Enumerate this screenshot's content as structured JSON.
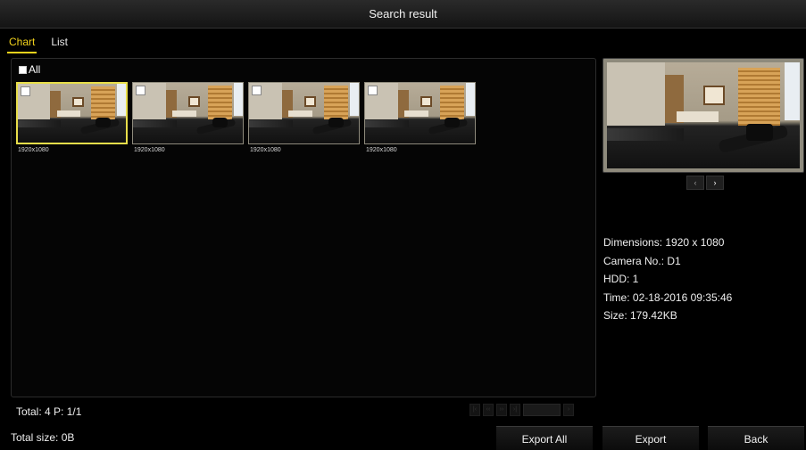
{
  "window": {
    "title": "Search result"
  },
  "tabs": [
    {
      "label": "Chart",
      "active": true
    },
    {
      "label": "List",
      "active": false
    }
  ],
  "select_all": {
    "label": "All",
    "checked": false
  },
  "thumbnails": [
    {
      "label": "1920x1080",
      "selected": true,
      "checked": false
    },
    {
      "label": "1920x1080",
      "selected": false,
      "checked": false
    },
    {
      "label": "1920x1080",
      "selected": false,
      "checked": false
    },
    {
      "label": "1920x1080",
      "selected": false,
      "checked": false
    }
  ],
  "preview": {
    "nav": {
      "prev_icon": "chevron-left-icon",
      "next_icon": "chevron-right-icon",
      "prev_glyph": "‹",
      "next_glyph": "›"
    }
  },
  "details": {
    "dimensions": "Dimensions: 1920 x 1080",
    "camera": "Camera No.: D1",
    "hdd": "HDD: 1",
    "time": "Time: 02-18-2016 09:35:46",
    "size": "Size: 179.42KB"
  },
  "footer": {
    "totals": "Total: 4  P: 1/1",
    "total_size": "Total size: 0B"
  },
  "buttons": {
    "export_all": "Export All",
    "export": "Export",
    "back": "Back"
  },
  "colors": {
    "accent": "#f2d21c",
    "selection_border": "#e8de4a",
    "background": "#000000"
  }
}
